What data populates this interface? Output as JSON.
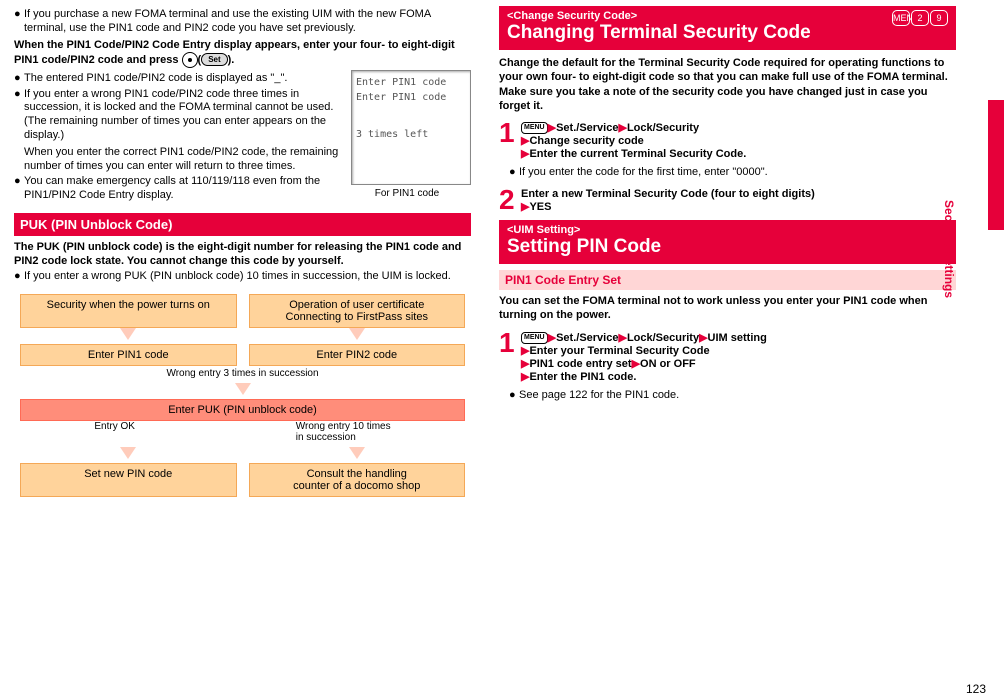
{
  "left": {
    "intro_bullet": "If you purchase a new FOMA terminal and use the existing UIM with the new FOMA terminal, use the PIN1 code and PIN2 code you have set previously.",
    "when_title": "When the PIN1 Code/PIN2 Code Entry display appears, enter your four- to eight-digit PIN1 code/PIN2 code and press ",
    "when_title_tail": "(",
    "set_btn": "Set",
    "when_title_end": ").",
    "b1": "The entered PIN1 code/PIN2 code is displayed as \"_\".",
    "b2": "If you enter a wrong PIN1 code/PIN2 code three times in succession, it is locked and the FOMA terminal cannot be used. (The remaining number of times you can enter appears on the display.)",
    "b2b": "When you enter the correct PIN1 code/PIN2 code, the remaining number of times you can enter will return to three times.",
    "b3": "You can make emergency calls at 110/119/118 even from the PIN1/PIN2 Code Entry display.",
    "screen": {
      "l1": "Enter PIN1 code",
      "l2": "Enter PIN1 code",
      "l3": "3 times left"
    },
    "caption": "For PIN1 code",
    "puk_title": "PUK (PIN Unblock Code)",
    "puk_text": "The PUK (PIN unblock code) is the eight-digit number for releasing the PIN1 code and PIN2 code lock state. You cannot change this code by yourself.",
    "puk_bullet": "If you enter a wrong PUK (PIN unblock code) 10 times in succession, the UIM is locked.",
    "flow": {
      "r1a": "Security when the power turns on",
      "r1b_l1": "Operation of user certificate",
      "r1b_l2": "Connecting to FirstPass sites",
      "r2a": "Enter PIN1 code",
      "r2b": "Enter PIN2 code",
      "wrong3": "Wrong entry 3 times in succession",
      "r3": "Enter PUK (PIN unblock code)",
      "ok": "Entry OK",
      "wrong10a": "Wrong entry 10 times",
      "wrong10b": "in succession",
      "r4a": "Set new PIN code",
      "r4b_l1": "Consult the handling",
      "r4b_l2": "counter of a docomo shop"
    }
  },
  "right": {
    "h1_sub": "<Change Security Code>",
    "h1_main": "Changing Terminal Security Code",
    "icon_menu": "MENU",
    "icon2": "2",
    "icon9": "9",
    "h1_text": "Change the default for the Terminal Security Code required for operating functions to your own four- to eight-digit code so that you can make full use of the FOMA terminal. Make sure you take a note of the security code you have changed just in case you forget it.",
    "s1_l1a": "Set./Service",
    "s1_l1b": "Lock/Security",
    "s1_l2": "Change security code",
    "s1_l3": "Enter the current Terminal Security Code.",
    "s1_note": "If you enter the code for the first time, enter \"0000\".",
    "s2": "Enter a new Terminal Security Code (four to eight digits)",
    "s2_yes": "YES",
    "h2_sub": "<UIM Setting>",
    "h2_main": "Setting PIN Code",
    "pink": "PIN1 Code Entry Set",
    "pink_text": "You can set the FOMA terminal not to work unless you enter your PIN1 code when turning on the power.",
    "p1_l1a": "Set./Service",
    "p1_l1b": "Lock/Security",
    "p1_l1c": "UIM setting",
    "p1_l2": "Enter your Terminal Security Code",
    "p1_l3a": "PIN1 code entry set",
    "p1_l3b": "ON or OFF",
    "p1_l4": "Enter the PIN1 code.",
    "p1_note": "See page 122 for the PIN1 code."
  },
  "side": "Security Settings",
  "page": "123"
}
